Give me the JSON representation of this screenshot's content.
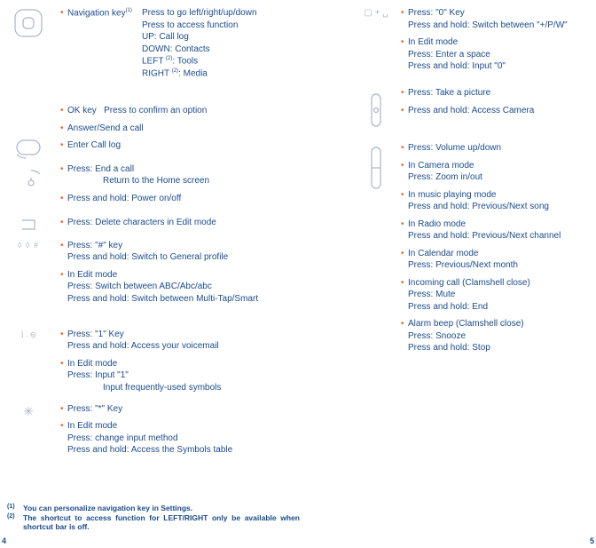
{
  "left": {
    "nav": {
      "label": "Navigation key",
      "sup": "(1)",
      "lines": [
        "Press to go left/right/up/down",
        "Press to access function",
        "UP: Call log",
        "DOWN: Contacts",
        "LEFT (2): Tools",
        "RIGHT (2): Media"
      ]
    },
    "ok": {
      "label": "OK key",
      "desc": "Press to confirm an option"
    },
    "answer": "Answer/Send a call",
    "enter_call_log": "Enter Call log",
    "end_call": {
      "l1": "Press: End a call",
      "l2": "Return to the Home screen"
    },
    "power": "Press and hold: Power on/off",
    "delete": "Press: Delete characters in Edit mode",
    "hash": {
      "l1": "Press: \"#\" key",
      "l2": "Press and hold: Switch to General profile"
    },
    "hash_edit": {
      "l1": "In Edit mode",
      "l2": "Press: Switch between ABC/Abc/abc",
      "l3": "Press and hold: Switch between Multi-Tap/Smart"
    },
    "one": {
      "l1": "Press: \"1\" Key",
      "l2": "Press and hold: Access your voicemail"
    },
    "one_edit": {
      "l1": "In Edit mode",
      "l2": "Press: Input \"1\"",
      "l3": "Input frequently-used symbols"
    },
    "star": "Press:  \"*\" Key",
    "star_edit": {
      "l1": "In Edit mode",
      "l2": "Press: change input method",
      "l3": "Press and hold: Access the Symbols table"
    }
  },
  "right": {
    "zero": {
      "l1": "Press: \"0\" Key",
      "l2": "Press and hold: Switch between \"+/P/W\""
    },
    "zero_edit": {
      "l1": "In Edit mode",
      "l2": "Press: Enter a space",
      "l3": "Press and hold: Input \"0\""
    },
    "cam1": "Press: Take a picture",
    "cam2": "Press and hold: Access Camera",
    "vol": "Press: Volume up/down",
    "cam_mode": {
      "l1": "In Camera mode",
      "l2": "Press: Zoom in/out"
    },
    "music": {
      "l1": "In music playing mode",
      "l2": "Press and hold: Previous/Next song"
    },
    "radio": {
      "l1": "In Radio mode",
      "l2": "Press and hold: Previous/Next channel"
    },
    "cal": {
      "l1": "In Calendar mode",
      "l2": "Press: Previous/Next month"
    },
    "incoming": {
      "l1": "Incoming call (Clamshell close)",
      "l2": "Press: Mute",
      "l3": "Press and hold: End"
    },
    "alarm": {
      "l1": "Alarm beep (Clamshell close)",
      "l2": "Press: Snooze",
      "l3": "Press and hold: Stop"
    }
  },
  "footnotes": {
    "f1": "You can personalize navigation key in Settings.",
    "f2": "The shortcut to access function for LEFT/RIGHT only be available when shortcut bar is off."
  },
  "pages": {
    "left": "4",
    "right": "5"
  }
}
